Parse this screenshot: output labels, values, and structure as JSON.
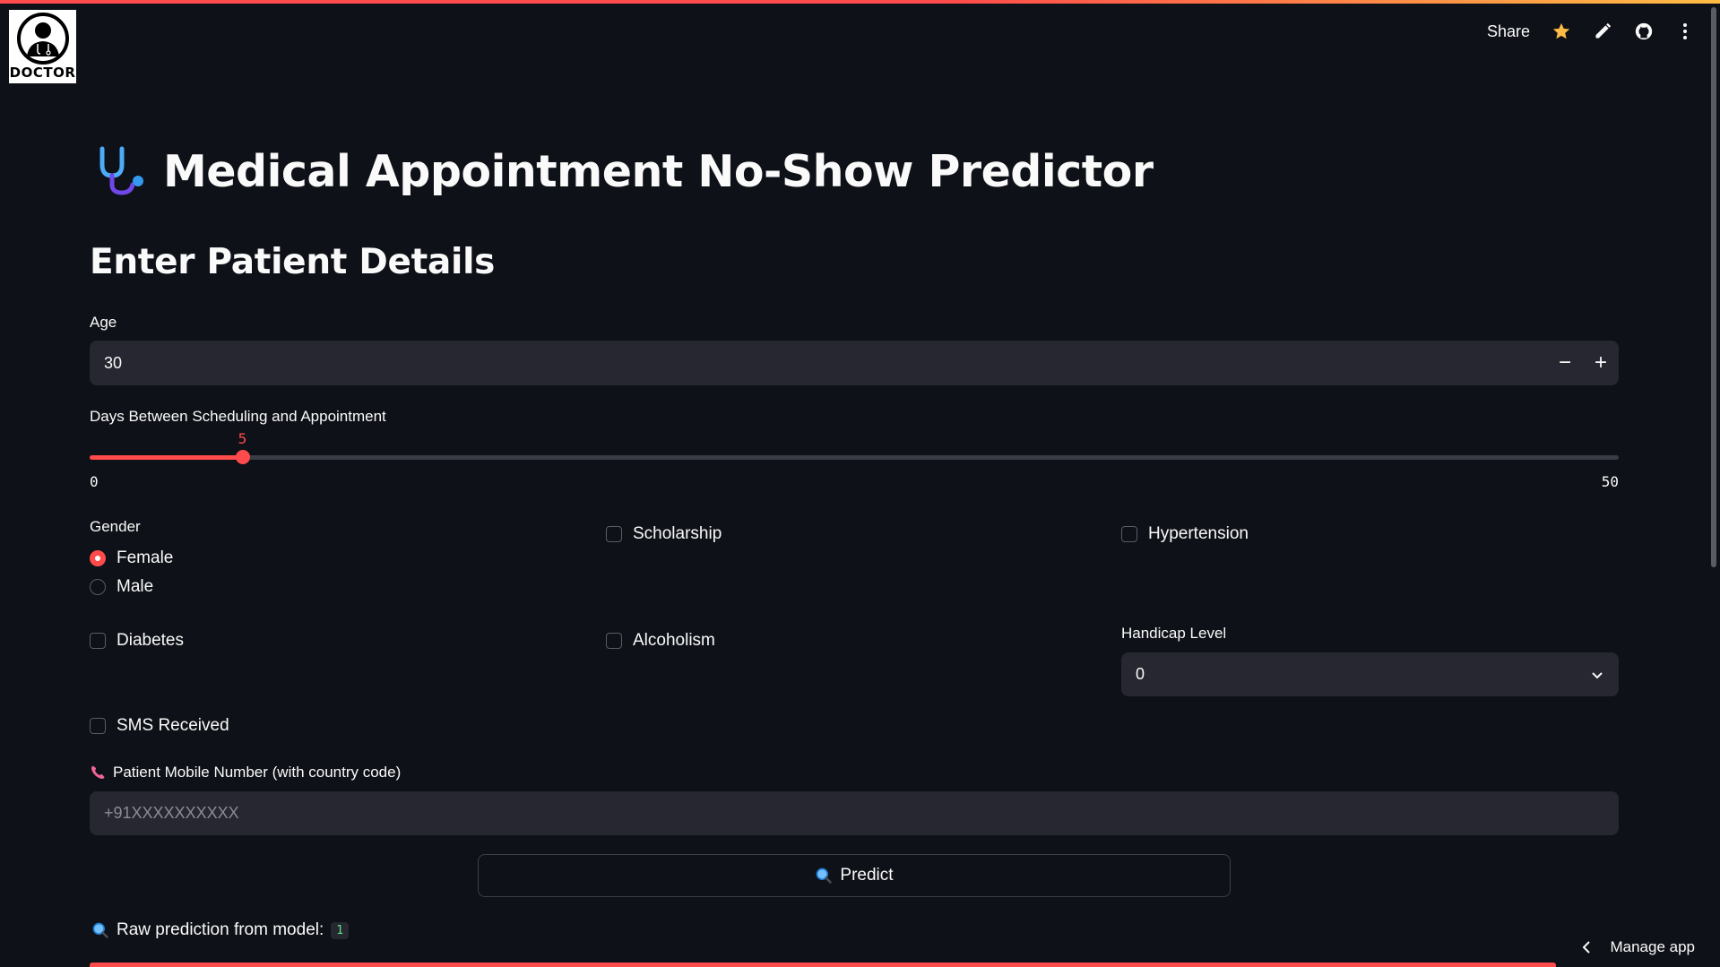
{
  "header": {
    "logo_text": "DOCTOR",
    "share_label": "Share",
    "icons": [
      "star-icon",
      "pencil-icon",
      "github-icon",
      "more-icon"
    ]
  },
  "page": {
    "title": "Medical Appointment No-Show Predictor",
    "title_icon": "stethoscope-icon",
    "subtitle": "Enter Patient Details"
  },
  "form": {
    "age": {
      "label": "Age",
      "value": "30",
      "minus": "−",
      "plus": "+"
    },
    "days": {
      "label": "Days Between Scheduling and Appointment",
      "value": "5",
      "min": "0",
      "max": "50",
      "fraction": 0.1
    },
    "gender": {
      "label": "Gender",
      "options": [
        {
          "label": "Female",
          "selected": true
        },
        {
          "label": "Male",
          "selected": false
        }
      ]
    },
    "scholarship": {
      "label": "Scholarship",
      "checked": false
    },
    "hypertension": {
      "label": "Hypertension",
      "checked": false
    },
    "diabetes": {
      "label": "Diabetes",
      "checked": false
    },
    "alcoholism": {
      "label": "Alcoholism",
      "checked": false
    },
    "handicap": {
      "label": "Handicap Level",
      "value": "0"
    },
    "sms": {
      "label": "SMS Received",
      "checked": false
    },
    "phone": {
      "label": "Patient Mobile Number (with country code)",
      "placeholder": "+91XXXXXXXXXX",
      "icon": "telephone-icon"
    },
    "predict_label": "Predict"
  },
  "result": {
    "raw_label": "Raw prediction from model:",
    "raw_value": "1"
  },
  "footer": {
    "manage_app": "Manage app"
  },
  "colors": {
    "background": "#0e1117",
    "accent": "#ff4b4b",
    "input_bg": "#262730"
  }
}
